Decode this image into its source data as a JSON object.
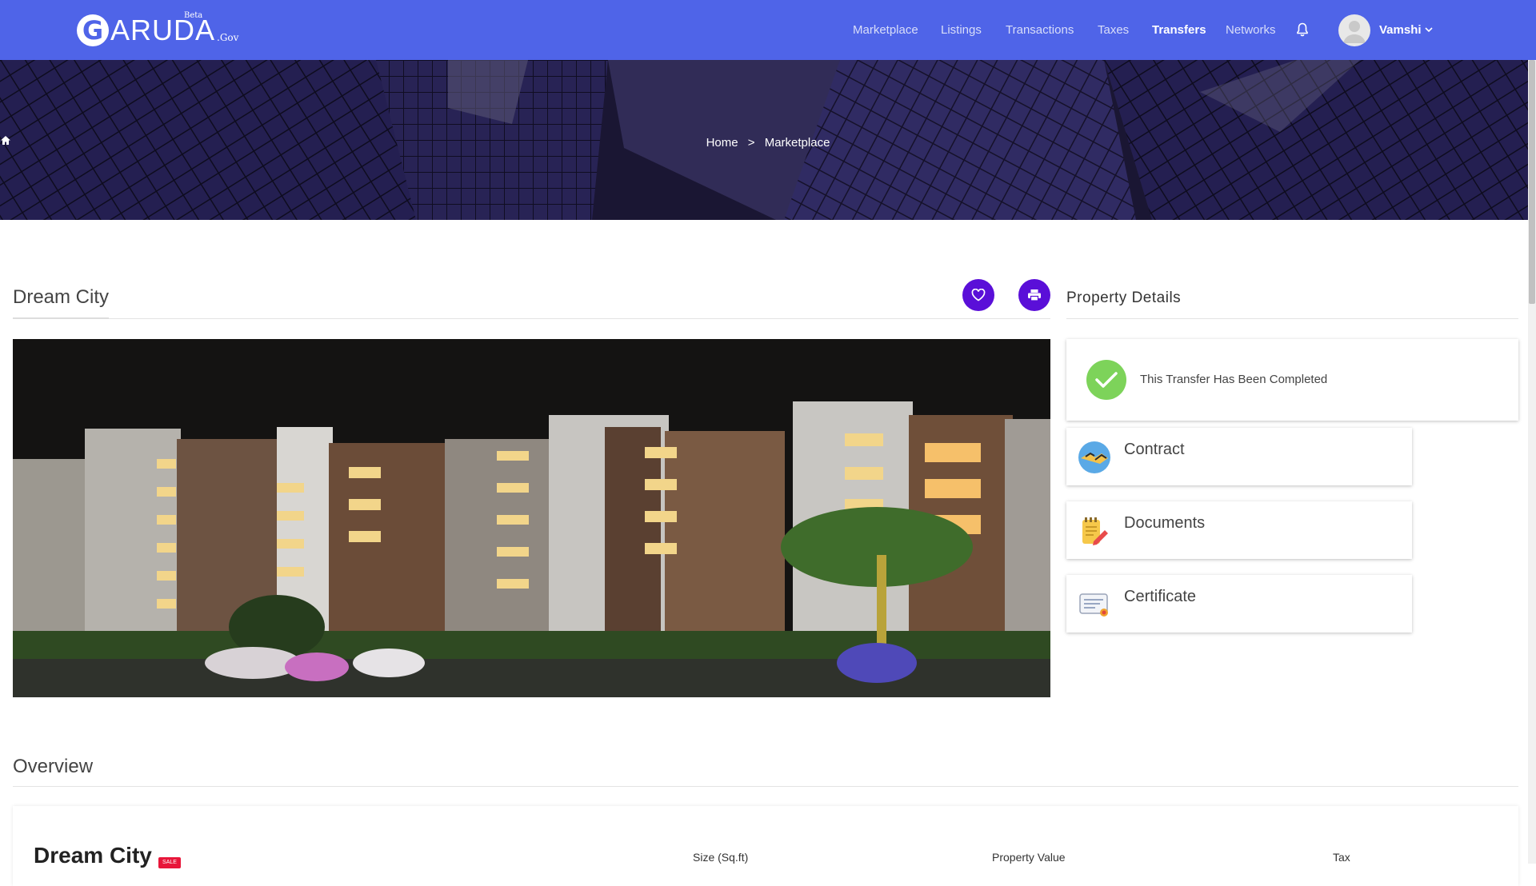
{
  "brand": {
    "logo_initial": "G",
    "logo_word": "ARUDA",
    "beta": "Beta",
    "gov": ".Gov",
    "primary_color": "#4f64e8",
    "accent_color": "#5a0fd8"
  },
  "nav": {
    "items": [
      {
        "label": "Marketplace",
        "active": false
      },
      {
        "label": "Listings",
        "active": false
      },
      {
        "label": "Transactions",
        "active": false
      },
      {
        "label": "Taxes",
        "active": false
      },
      {
        "label": "Transfers",
        "active": true
      },
      {
        "label": "Networks",
        "active": false
      }
    ],
    "notification_icon": "bell-icon",
    "user": {
      "name": "Vamshi",
      "avatar_icon": "user-avatar-icon",
      "menu_icon": "chevron-down-icon"
    }
  },
  "breadcrumb": {
    "home_icon": "home-icon",
    "home": "Home",
    "separator": ">",
    "current": "Marketplace"
  },
  "property": {
    "title": "Dream City",
    "favorite_icon": "heart-icon",
    "print_icon": "print-icon"
  },
  "details": {
    "title": "Property Details",
    "status_icon": "check-icon",
    "status_text": "This Transfer Has Been Completed",
    "status_color": "#7dd35a",
    "documents": [
      {
        "label": "Contract",
        "icon": "contract-icon"
      },
      {
        "label": "Documents",
        "icon": "documents-icon"
      },
      {
        "label": "Certificate",
        "icon": "certificate-icon"
      }
    ]
  },
  "overview": {
    "title": "Overview",
    "name": "Dream City",
    "badge": "SALE",
    "columns": [
      "Size (Sq.ft)",
      "Property Value",
      "Tax"
    ]
  }
}
